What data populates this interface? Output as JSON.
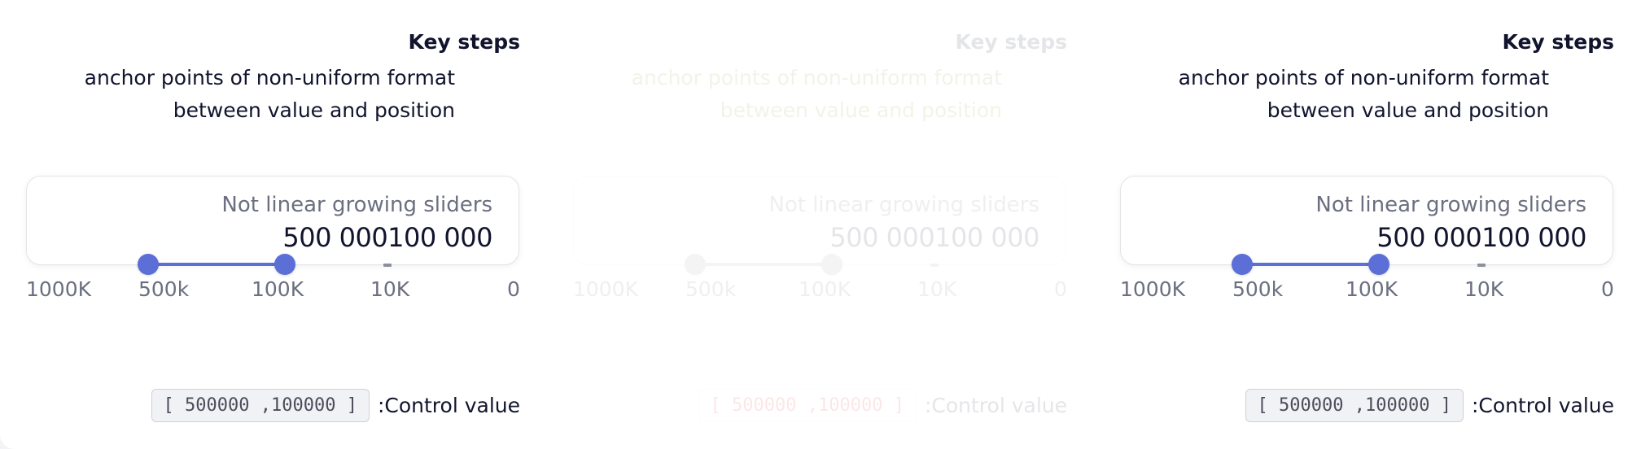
{
  "panels": [
    {
      "title": "Key steps",
      "description_line1": "anchor points of non-uniform format",
      "description_line2": "between value and position",
      "card_label": "Not linear growing sliders",
      "value_low": "500 000",
      "value_high": "100 000",
      "scale": [
        "1000K",
        "500k",
        "100K",
        "10K",
        "0"
      ],
      "control_value": "[ 500000 ,100000 ]",
      "control_label": ":Control value"
    },
    {
      "title": "Key steps",
      "description_line1": "anchor points of non-uniform format",
      "description_line2": "between value and position",
      "card_label": "Not linear growing sliders",
      "value_low": "500 000",
      "value_high": "100 000",
      "scale": [
        "1000K",
        "500k",
        "100K",
        "10K",
        "0"
      ],
      "control_value": "[ 500000 ,100000 ]",
      "control_label": ":Control value"
    },
    {
      "title": "Key steps",
      "description_line1": "anchor points of non-uniform format",
      "description_line2": "between value and position",
      "card_label": "Not linear growing sliders",
      "value_low": "500 000",
      "value_high": "100 000",
      "scale": [
        "1000K",
        "500k",
        "100K",
        "10K",
        "0"
      ],
      "control_value": "[ 500000 ,100000 ]",
      "control_label": ":Control value"
    }
  ],
  "colors": {
    "accent": "#5b6fd6",
    "text": "#11142d",
    "muted": "#6b6f80"
  }
}
